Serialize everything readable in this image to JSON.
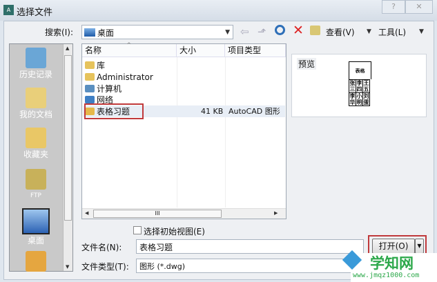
{
  "window": {
    "title": "选择文件",
    "help": "?",
    "close": "✕"
  },
  "toolbar": {
    "search_label": "搜索(I):",
    "location": "桌面",
    "view_label": "查看(V)",
    "tools_label": "工具(L)"
  },
  "sidebar": {
    "items": [
      {
        "label": "历史记录",
        "color": "#6aa6d6"
      },
      {
        "label": "我的文档",
        "color": "#e9cf7a"
      },
      {
        "label": "收藏夹",
        "color": "#e9c766"
      },
      {
        "label": "FTP",
        "color": "#c8b15a"
      },
      {
        "label": "桌面",
        "color": "#3a78c8"
      },
      {
        "label": "",
        "color": "#e5a640"
      }
    ]
  },
  "list": {
    "columns": [
      "名称",
      "大小",
      "项目类型"
    ],
    "rows": [
      {
        "name": "库",
        "size": "",
        "type": "",
        "color": "#e6c35c"
      },
      {
        "name": "Administrator",
        "size": "",
        "type": "",
        "color": "#e6c35c"
      },
      {
        "name": "计算机",
        "size": "",
        "type": "",
        "color": "#5a8fc0"
      },
      {
        "name": "网络",
        "size": "",
        "type": "",
        "color": "#3e7fc4"
      },
      {
        "name": "表格习题",
        "size": "41 KB",
        "type": "AutoCAD 图形",
        "color": "#e6b84a"
      }
    ],
    "hscroll_thumb": "III"
  },
  "preview": {
    "label": "预览",
    "table_title": "表格",
    "cells": [
      [
        "张三",
        "李四",
        "王五"
      ],
      [
        "李华",
        "小明",
        "刘蛋"
      ]
    ]
  },
  "checkbox": {
    "label": "选择初始视图(E)",
    "checked": false
  },
  "filename": {
    "label": "文件名(N):",
    "value": "表格习题"
  },
  "filetype": {
    "label": "文件类型(T):",
    "value": "图形 (*.dwg)"
  },
  "open_button": "打开(O)",
  "watermark": {
    "name": "学知网",
    "url": "www.jmqz1000.com"
  },
  "highlight_color": "#c0393b"
}
